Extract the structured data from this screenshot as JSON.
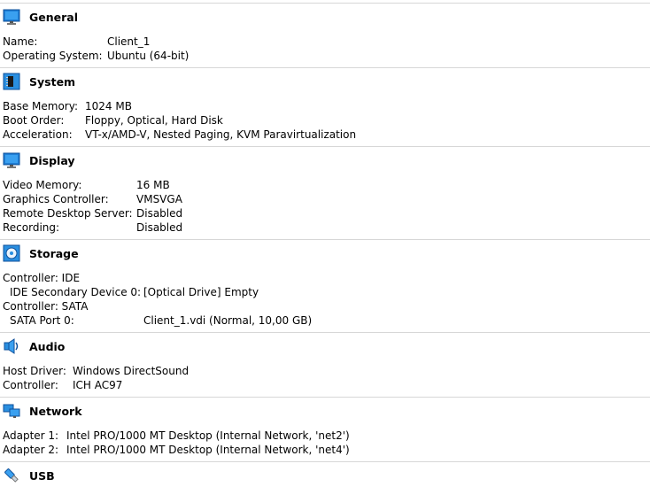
{
  "sections": {
    "general": {
      "title": "General",
      "rows": [
        {
          "label": "Name:",
          "value": "Client_1"
        },
        {
          "label": "Operating System:",
          "value": "Ubuntu (64-bit)"
        }
      ]
    },
    "system": {
      "title": "System",
      "rows": [
        {
          "label": "Base Memory:",
          "value": "1024 MB"
        },
        {
          "label": "Boot Order:",
          "value": "Floppy, Optical, Hard Disk"
        },
        {
          "label": "Acceleration:",
          "value": "VT-x/AMD-V, Nested Paging, KVM Paravirtualization"
        }
      ]
    },
    "display": {
      "title": "Display",
      "rows": [
        {
          "label": "Video Memory:",
          "value": "16 MB"
        },
        {
          "label": "Graphics Controller:",
          "value": "VMSVGA"
        },
        {
          "label": "Remote Desktop Server:",
          "value": "Disabled"
        },
        {
          "label": "Recording:",
          "value": "Disabled"
        }
      ]
    },
    "storage": {
      "title": "Storage",
      "rows": [
        {
          "label": "Controller: IDE",
          "value": ""
        },
        {
          "label": "IDE Secondary Device 0:",
          "value": "[Optical Drive] Empty"
        },
        {
          "label": "Controller: SATA",
          "value": ""
        },
        {
          "label": "SATA Port 0:",
          "value": "Client_1.vdi (Normal, 10,00 GB)"
        }
      ]
    },
    "audio": {
      "title": "Audio",
      "rows": [
        {
          "label": "Host Driver:",
          "value": "Windows DirectSound"
        },
        {
          "label": "Controller:",
          "value": "ICH AC97"
        }
      ]
    },
    "network": {
      "title": "Network",
      "rows": [
        {
          "label": "Adapter 1:",
          "value": "Intel PRO/1000 MT Desktop (Internal Network, 'net2')"
        },
        {
          "label": "Adapter 2:",
          "value": "Intel PRO/1000 MT Desktop (Internal Network, 'net4')"
        }
      ]
    },
    "usb": {
      "title": "USB"
    }
  }
}
